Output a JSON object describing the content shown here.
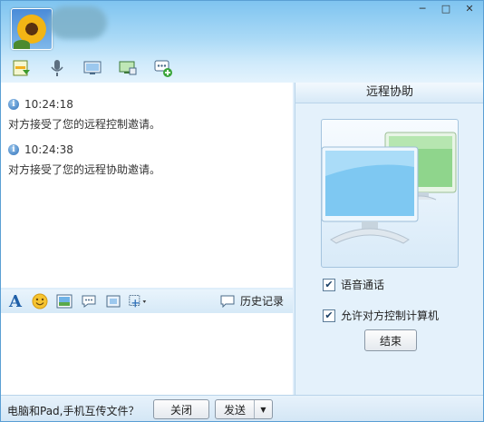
{
  "window": {
    "controls": {
      "minimize": "─",
      "maximize": "□",
      "close": "✕"
    }
  },
  "toolbar": {
    "icons": [
      "file-transfer-icon",
      "voice-icon",
      "video-icon",
      "remote-desktop-icon",
      "add-app-icon"
    ]
  },
  "chat": {
    "messages": [
      {
        "time": "10:24:18",
        "text": "对方接受了您的远程控制邀请。"
      },
      {
        "time": "10:24:38",
        "text": "对方接受了您的远程协助邀请。"
      }
    ]
  },
  "format_bar": {
    "icons": [
      "font-icon",
      "emoji-icon",
      "image-icon",
      "quick-reply-icon",
      "screenshot-icon",
      "screen-capture-icon"
    ],
    "history_label": "历史记录"
  },
  "bottom": {
    "promo": "电脑和Pad,手机互传文件？",
    "close_label": "关闭",
    "send_label": "发送"
  },
  "remote": {
    "title": "远程协助",
    "voice_label": "语音通话",
    "voice_checked": true,
    "allow_control_label": "允许对方控制计算机",
    "allow_control_checked": true,
    "end_label": "结束"
  },
  "colors": {
    "accent": "#2d6fb8",
    "title_bg": "#a9d9f6",
    "panel_bg": "#e4f1fb",
    "monitor_blue": "#7ec8f2",
    "monitor_green": "#8fd58c"
  }
}
